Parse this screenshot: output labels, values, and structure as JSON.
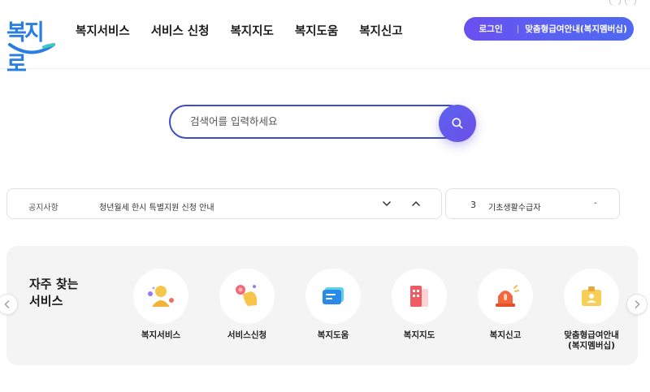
{
  "header": {
    "logo_text": "복지로",
    "nav": [
      "복지서비스",
      "서비스 신청",
      "복지지도",
      "복지도움",
      "복지신고"
    ],
    "login_label": "로그인",
    "guide_label": "맞춤형급여안내(복지멤버십)"
  },
  "search": {
    "placeholder": "검색어를 입력하세요"
  },
  "notice": {
    "label": "공지사항",
    "text": "청년월세 한시 특별지원 신청 안내"
  },
  "ranking": {
    "rank": "3",
    "name": "기초생활수급자",
    "change": "-"
  },
  "favorites": {
    "title_line1": "자주 찾는",
    "title_line2": "서비스",
    "items": [
      {
        "label": "복지서비스",
        "icon": "person-icon"
      },
      {
        "label": "서비스신청",
        "icon": "hand-tap-icon"
      },
      {
        "label": "복지도움",
        "icon": "chat-bubble-icon"
      },
      {
        "label": "복지지도",
        "icon": "map-building-icon"
      },
      {
        "label": "복지신고",
        "icon": "siren-icon"
      },
      {
        "label": "맞춤형급여안내",
        "label2": "(복지멤버십)",
        "icon": "id-card-icon"
      }
    ]
  },
  "colors": {
    "brand": "#2a7de1",
    "accent_start": "#6a4ff0",
    "accent_end": "#4f69f0",
    "search_border": "#3b4fbf"
  }
}
